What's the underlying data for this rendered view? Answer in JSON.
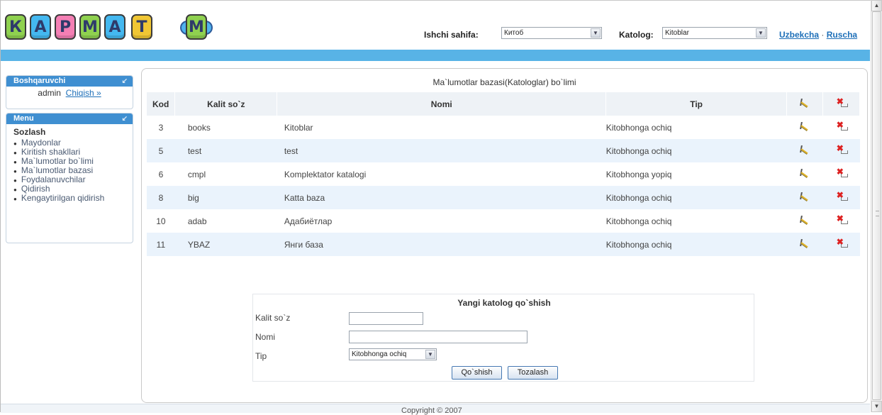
{
  "logo": {
    "letters": [
      "К",
      "А",
      "Р",
      "М",
      "А",
      "Т",
      "М"
    ],
    "colors": [
      "#8fd14f",
      "#44b8f0",
      "#f47fb4",
      "#8fd14f",
      "#44b8f0",
      "#f0c634",
      "#8fd14f"
    ]
  },
  "header": {
    "work_page_label": "Ishchi sahifa:",
    "work_page_value": "Китоб",
    "catalog_label": "Katolog:",
    "catalog_value": "Kitoblar",
    "lang_uz": "Uzbekcha",
    "lang_sep": "·",
    "lang_ru": "Ruscha"
  },
  "sidebar": {
    "admin_title": "Boshqaruvchi",
    "admin_user": "admin",
    "logout": "Chiqish »",
    "menu_title": "Menu",
    "menu_section": "Sozlash",
    "menu_items": [
      "Maydonlar",
      "Kiritish shakllari",
      "Ma`lumotlar bo`limi",
      "Ma`lumotlar bazasi",
      "Foydalanuvchilar",
      "Qidirish",
      "Kengaytirilgan qidirish"
    ]
  },
  "main": {
    "title": "Ma`lumotlar bazasi(Katologlar) bo`limi",
    "columns": {
      "kod": "Kod",
      "key": "Kalit so`z",
      "nomi": "Nomi",
      "tip": "Tip"
    },
    "rows": [
      {
        "kod": "3",
        "key": "books",
        "nomi": "Kitoblar",
        "tip": "Kitobhonga ochiq"
      },
      {
        "kod": "5",
        "key": "test",
        "nomi": "test",
        "tip": "Kitobhonga ochiq"
      },
      {
        "kod": "6",
        "key": "cmpl",
        "nomi": "Komplektator katalogi",
        "tip": "Kitobhonga yopiq"
      },
      {
        "kod": "8",
        "key": "big",
        "nomi": "Katta baza",
        "tip": "Kitobhonga ochiq"
      },
      {
        "kod": "10",
        "key": "adab",
        "nomi": "Адабиётлар",
        "tip": "Kitobhonga ochiq"
      },
      {
        "kod": "11",
        "key": "YBAZ",
        "nomi": "Янги база",
        "tip": "Kitobhonga ochiq"
      }
    ]
  },
  "add_form": {
    "title": "Yangi katolog qo`shish",
    "key_label": "Kalit so`z",
    "key_value": "",
    "name_label": "Nomi",
    "name_value": "",
    "type_label": "Tip",
    "type_value": "Kitobhonga ochiq",
    "add_button": "Qo`shish",
    "clear_button": "Tozalash"
  },
  "footer": {
    "copyright": "Copyright © 2007"
  }
}
